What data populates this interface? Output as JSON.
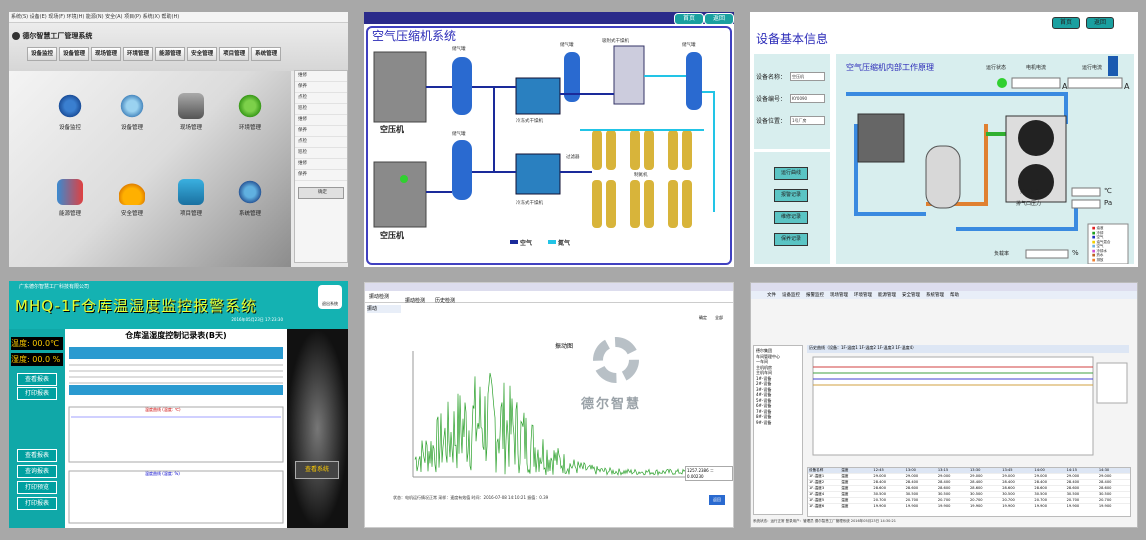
{
  "panel1": {
    "logo": "德尔智慧工厂管理系统",
    "nav": [
      "设备监控",
      "设备管理",
      "现场管理",
      "环境管理",
      "能源管理",
      "安全管理",
      "项目管理",
      "系统管理"
    ],
    "icons": [
      "设备监控",
      "设备管理",
      "现场管理",
      "环境管理",
      "能源管理",
      "安全管理",
      "项目管理",
      "系统管理"
    ],
    "side_rows": [
      "维修",
      "保养",
      "点检",
      "巡检",
      "维修",
      "保养",
      "点检",
      "巡检",
      "维修",
      "保养"
    ],
    "side_footer": "确定"
  },
  "panel2": {
    "title": "空气压缩机系统",
    "btn_home": "首页",
    "btn_back": "返回",
    "labels": {
      "tank1": "储气罐",
      "tank2": "储气罐",
      "tank3": "储气罐",
      "tank4": "储气罐",
      "comp1": "空压机",
      "comp2": "空压机",
      "dryer1": "冷冻式干燥机",
      "dryer2": "冷冻式干燥机",
      "adsorb": "吸附式干燥机",
      "filter": "过滤器",
      "nitrogen": "制氮机"
    },
    "legend": [
      {
        "label": "空气",
        "color": "#1a2a9a"
      },
      {
        "label": "氮气",
        "color": "#22c4e6"
      }
    ]
  },
  "panel3": {
    "title": "设备基本信息",
    "btn_home": "首页",
    "btn_back": "返回",
    "fields": [
      {
        "label": "设备名称：",
        "value": "空压机"
      },
      {
        "label": "设备编号：",
        "value": "KY0090"
      },
      {
        "label": "设备位置：",
        "value": "1号厂房"
      }
    ],
    "side_buttons": [
      "运行曲线",
      "报警记录",
      "维修记录",
      "保养记录"
    ],
    "inner_title": "空气压缩机内部工作原理",
    "status_labels": [
      "运行状态",
      "电机电流",
      "运行电流"
    ],
    "units": [
      "A",
      "A"
    ],
    "readouts": [
      {
        "label": "排气温度",
        "unit": "℃"
      },
      {
        "label": "排气口压力",
        "unit": "Pa"
      },
      {
        "label": "负载率",
        "unit": "%"
      }
    ],
    "legend": [
      {
        "label": "油液",
        "color": "#e02020"
      },
      {
        "label": "冷却",
        "color": "#20a020"
      },
      {
        "label": "空气",
        "color": "#2030c0"
      },
      {
        "label": "油气混合",
        "color": "#f0d000"
      },
      {
        "label": "空气",
        "color": "#70b0e0"
      },
      {
        "label": "冷却水",
        "color": "#d050d0"
      },
      {
        "label": "热水",
        "color": "#c06020"
      },
      {
        "label": "排放",
        "color": "#f08030"
      }
    ]
  },
  "panel4": {
    "company": "广东德尔智慧工厂科技有限公司",
    "big_title": "MHQ-1F仓库温湿度监控报警系统",
    "login": "退出系统",
    "table_title": "仓库温湿度控制记录表(B天)",
    "temp": "温度: 00.0℃",
    "hum": "湿度: 00.0 %",
    "left_buttons": [
      "查看报表",
      "打印报表",
      "查看报表",
      "查询报表",
      "打印预览",
      "打印报表"
    ],
    "chart1": "温度曲线 (温度: ℃)",
    "chart2": "温度曲线 (湿度: %)",
    "right_btn": "查看系统",
    "date": "2016年05月23日 17:23:30"
  },
  "panel5": {
    "tabs": [
      "振动检测",
      "历史检测"
    ],
    "subtab": "振动",
    "buttons": [
      "确定",
      "全部"
    ],
    "chart_title": "振动图",
    "brand": "德尔智慧",
    "status": "状态：电机运行情况正常  采样：速度有效值  时间：2016-07-08 14:10:21  振值：0.39",
    "tooltip": "1257.2386 ＝ 0.00230",
    "btn_ok": "返回"
  },
  "panel6": {
    "menu": [
      "文件",
      "设备监控",
      "报警监控",
      "现场管理",
      "环境管理",
      "能源管理",
      "安全管理",
      "系统管理",
      "帮助"
    ],
    "tree": [
      "德尔集团",
      "车间管理中心",
      "一车间",
      "主机机房",
      "主机车间",
      "1#-设备",
      "2#-设备",
      "3#-设备",
      "4#-设备",
      "5#-设备",
      "6#-设备",
      "7#-设备",
      "8#-设备",
      "9#-设备"
    ],
    "chart_header": "历史曲线（设备：1F-温度1 1F-温度2 1F-温度3 1F-温度4）",
    "table_cols": [
      "设备名称",
      "温度",
      "12:45",
      "13:00",
      "13:15",
      "13:30",
      "13:45",
      "14:00",
      "14:15",
      "14:30"
    ],
    "table_rows": [
      [
        "1F-温度1",
        "温度",
        "29.000",
        "29.000",
        "29.000",
        "29.000",
        "29.000",
        "29.000",
        "29.000",
        "29.000"
      ],
      [
        "1F-温度2",
        "温度",
        "28.400",
        "28.400",
        "28.400",
        "28.400",
        "28.400",
        "28.400",
        "28.400",
        "28.400"
      ],
      [
        "1F-温度3",
        "温度",
        "28.600",
        "28.600",
        "28.600",
        "28.600",
        "28.600",
        "28.600",
        "28.600",
        "28.600"
      ],
      [
        "1F-温度4",
        "温度",
        "30.500",
        "30.500",
        "30.500",
        "30.500",
        "30.500",
        "30.500",
        "30.500",
        "30.500"
      ],
      [
        "1F-温度5",
        "温度",
        "20.700",
        "20.700",
        "20.700",
        "20.700",
        "20.700",
        "20.700",
        "20.700",
        "20.700"
      ],
      [
        "1F-温度6",
        "温度",
        "19.900",
        "19.900",
        "19.900",
        "19.900",
        "19.900",
        "19.900",
        "19.900",
        "19.900"
      ]
    ],
    "status": "系统状态：运行正常  登录用户：管理员  德尔智慧工厂管理系统  2016年05月23日 14:30:21"
  }
}
